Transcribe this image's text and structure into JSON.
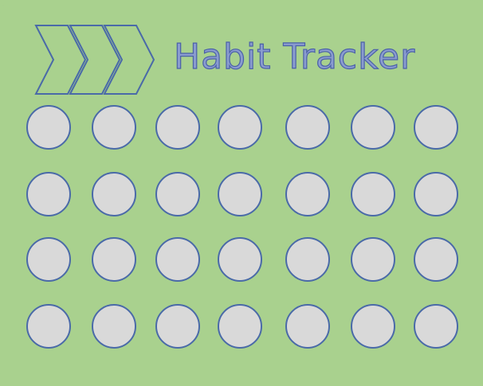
{
  "title": "Habit Tracker",
  "icon": "triple-chevron-right-icon",
  "colors": {
    "background": "#a9d18e",
    "circle_fill": "#d9d9d9",
    "circle_border": "#4a6aa8",
    "title_fill": "#8a9ccf",
    "title_stroke": "#4a60a8"
  },
  "tracker": {
    "rows": 4,
    "columns": 7,
    "checked": []
  }
}
